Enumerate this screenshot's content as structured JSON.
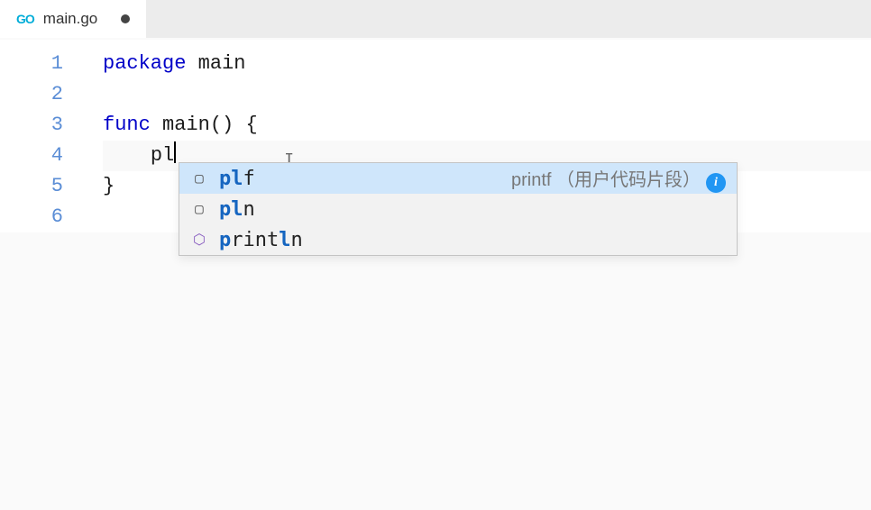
{
  "tab": {
    "icon_label": "GO",
    "filename": "main.go"
  },
  "gutter": [
    "1",
    "2",
    "3",
    "4",
    "5",
    "6"
  ],
  "code": {
    "line1_kw": "package",
    "line1_ident": "main",
    "line3_kw": "func",
    "line3_ident": "main",
    "line3_paren": "()",
    "line3_brace": "{",
    "line4_text": "pl",
    "line5_brace": "}"
  },
  "suggest": {
    "items": [
      {
        "prefix": "pl",
        "rest": "f",
        "detail": "printf （用户代码片段）",
        "has_info": true,
        "kind": "snippet"
      },
      {
        "prefix": "pl",
        "rest": "n",
        "detail": "",
        "has_info": false,
        "kind": "snippet"
      },
      {
        "prefix_full": "println",
        "detail": "",
        "has_info": false,
        "kind": "func"
      }
    ]
  }
}
